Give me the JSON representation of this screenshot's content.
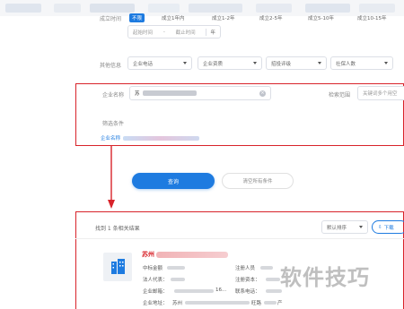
{
  "filters": {
    "established_time": {
      "label": "成立时间",
      "options": [
        "不限",
        "成立1年内",
        "成立1-2年",
        "成立2-5年",
        "成立5-10年",
        "成立10-15年"
      ],
      "selected": "不限",
      "start_placeholder": "起始时间",
      "dash": "-",
      "end_placeholder": "截止时间",
      "unit": "年"
    },
    "other_info": {
      "label": "其他信息",
      "dropdowns": [
        "企业电话",
        "企业资质",
        "招投评级",
        "社保人数"
      ]
    }
  },
  "search_panel": {
    "company_name_label": "企业名称",
    "company_name_value": "苏",
    "search_scope_label": "检索范围",
    "search_scope_placeholder": "关键词多个用空",
    "filter_conditions_label": "筛选条件",
    "filter_tag_label": "企业名称"
  },
  "actions": {
    "query_label": "查询",
    "clear_label": "清空所有条件"
  },
  "results": {
    "summary": "找到 1 条相关结果",
    "sort_label": "默认排序",
    "download_label": "下载",
    "company": {
      "name_prefix": "苏州",
      "bid_label": "中标金额",
      "registrant_label": "注册人员",
      "legal_rep_label": "法人代表：",
      "registered_capital_label": "注册资本：",
      "email_label": "企业邮箱：",
      "email_suffix": "16...",
      "phone_label": "联系电话：",
      "address_label": "企业地址：",
      "address_prefix": "苏州",
      "address_mid": "旺路",
      "address_suffix": "产"
    }
  },
  "watermark": "软件技巧",
  "colors": {
    "primary": "#1e7be0",
    "highlight_red": "#d8232a"
  }
}
